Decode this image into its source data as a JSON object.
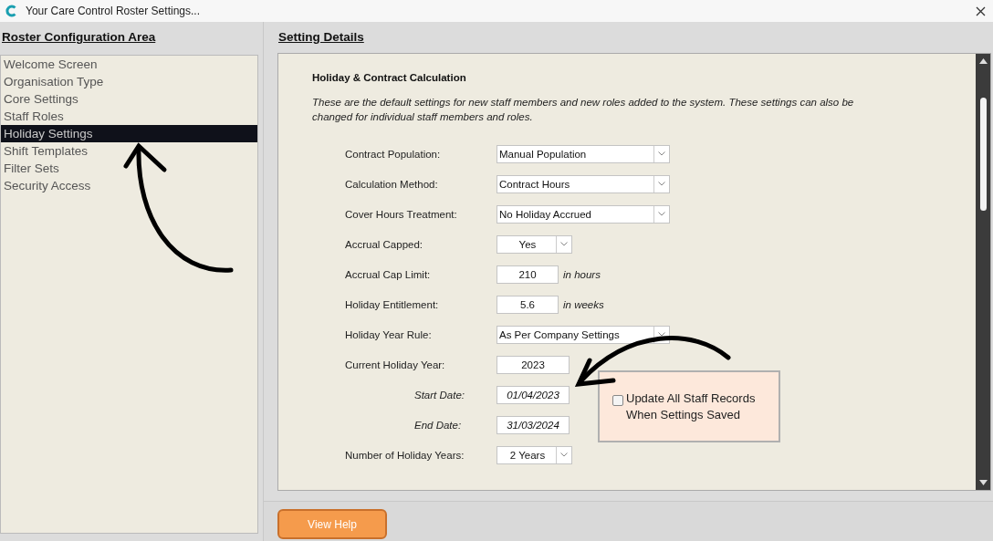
{
  "window": {
    "title": "Your Care Control Roster Settings..."
  },
  "sidebar": {
    "title": "Roster Configuration Area",
    "items": [
      {
        "label": "Welcome Screen",
        "selected": false
      },
      {
        "label": "Organisation Type",
        "selected": false
      },
      {
        "label": "Core Settings",
        "selected": false
      },
      {
        "label": "Staff Roles",
        "selected": false
      },
      {
        "label": "Holiday Settings",
        "selected": true
      },
      {
        "label": "Shift Templates",
        "selected": false
      },
      {
        "label": "Filter Sets",
        "selected": false
      },
      {
        "label": "Security Access",
        "selected": false
      }
    ]
  },
  "details": {
    "title": "Setting Details",
    "section_title": "Holiday & Contract Calculation",
    "description": "These are the default settings for new staff members and new roles added to the system.  These settings can also be changed for individual staff members and roles.",
    "fields": [
      {
        "kind": "dropdown",
        "label": "Contract Population:",
        "value": "Manual Population"
      },
      {
        "kind": "dropdown",
        "label": "Calculation Method:",
        "value": "Contract Hours"
      },
      {
        "kind": "dropdown",
        "label": "Cover Hours Treatment:",
        "value": "No Holiday Accrued"
      },
      {
        "kind": "short-dropdown",
        "label": "Accrual Capped:",
        "value": "Yes"
      },
      {
        "kind": "number",
        "label": "Accrual Cap Limit:",
        "value": "210",
        "unit": "in hours"
      },
      {
        "kind": "number",
        "label": "Holiday Entitlement:",
        "value": "5.6",
        "unit": "in weeks"
      },
      {
        "kind": "dropdown",
        "label": "Holiday Year Rule:",
        "value": "As Per Company Settings"
      },
      {
        "kind": "year",
        "label": "Current Holiday Year:",
        "value": "2023"
      },
      {
        "kind": "date",
        "label": "Start Date:",
        "value": "01/04/2023"
      },
      {
        "kind": "date",
        "label": "End Date:",
        "value": "31/03/2024"
      },
      {
        "kind": "short-dropdown",
        "label": "Number of Holiday Years:",
        "value": "2 Years"
      }
    ],
    "update_option": {
      "label": "Update All Staff Records When Settings Saved",
      "checked": false
    }
  },
  "buttons": [
    {
      "label": "View Help"
    }
  ]
}
